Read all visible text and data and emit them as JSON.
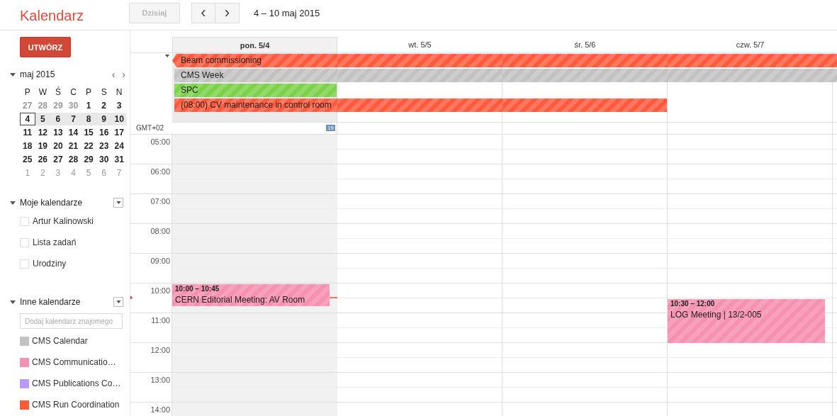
{
  "app_title": "Kalendarz",
  "toolbar": {
    "today_button": "Dzisiaj",
    "today_disabled": true,
    "prev": "‹",
    "next": "›",
    "range": "4 – 10 maj 2015"
  },
  "create_button": "UTWÓRZ",
  "mini_calendar": {
    "month": "maj 2015",
    "prev": "‹",
    "next": "›",
    "weekdays": [
      "P",
      "W",
      "Ś",
      "C",
      "P",
      "S",
      "N"
    ],
    "weeks": [
      {
        "selected": false,
        "days": [
          {
            "label": "27",
            "other_month": true,
            "selected": false
          },
          {
            "label": "28",
            "other_month": true,
            "selected": false
          },
          {
            "label": "29",
            "other_month": true,
            "selected": false
          },
          {
            "label": "30",
            "other_month": true,
            "selected": false
          },
          {
            "label": "1",
            "other_month": false,
            "selected": false
          },
          {
            "label": "2",
            "other_month": false,
            "selected": false
          },
          {
            "label": "3",
            "other_month": false,
            "selected": false
          }
        ]
      },
      {
        "selected": true,
        "days": [
          {
            "label": "4",
            "other_month": false,
            "selected": true
          },
          {
            "label": "5",
            "other_month": false,
            "selected": false
          },
          {
            "label": "6",
            "other_month": false,
            "selected": false
          },
          {
            "label": "7",
            "other_month": false,
            "selected": false
          },
          {
            "label": "8",
            "other_month": false,
            "selected": false
          },
          {
            "label": "9",
            "other_month": false,
            "selected": false
          },
          {
            "label": "10",
            "other_month": false,
            "selected": false
          }
        ]
      },
      {
        "selected": false,
        "days": [
          {
            "label": "11",
            "other_month": false,
            "selected": false
          },
          {
            "label": "12",
            "other_month": false,
            "selected": false
          },
          {
            "label": "13",
            "other_month": false,
            "selected": false
          },
          {
            "label": "14",
            "other_month": false,
            "selected": false
          },
          {
            "label": "15",
            "other_month": false,
            "selected": false
          },
          {
            "label": "16",
            "other_month": false,
            "selected": false
          },
          {
            "label": "17",
            "other_month": false,
            "selected": false
          }
        ]
      },
      {
        "selected": false,
        "days": [
          {
            "label": "18",
            "other_month": false,
            "selected": false
          },
          {
            "label": "19",
            "other_month": false,
            "selected": false
          },
          {
            "label": "20",
            "other_month": false,
            "selected": false
          },
          {
            "label": "21",
            "other_month": false,
            "selected": false
          },
          {
            "label": "22",
            "other_month": false,
            "selected": false
          },
          {
            "label": "23",
            "other_month": false,
            "selected": false
          },
          {
            "label": "24",
            "other_month": false,
            "selected": false
          }
        ]
      },
      {
        "selected": false,
        "days": [
          {
            "label": "25",
            "other_month": false,
            "selected": false
          },
          {
            "label": "26",
            "other_month": false,
            "selected": false
          },
          {
            "label": "27",
            "other_month": false,
            "selected": false
          },
          {
            "label": "28",
            "other_month": false,
            "selected": false
          },
          {
            "label": "29",
            "other_month": false,
            "selected": false
          },
          {
            "label": "30",
            "other_month": false,
            "selected": false
          },
          {
            "label": "31",
            "other_month": false,
            "selected": false
          }
        ]
      },
      {
        "selected": false,
        "days": [
          {
            "label": "1",
            "other_month": true,
            "selected": false
          },
          {
            "label": "2",
            "other_month": true,
            "selected": false
          },
          {
            "label": "3",
            "other_month": true,
            "selected": false
          },
          {
            "label": "4",
            "other_month": true,
            "selected": false
          },
          {
            "label": "5",
            "other_month": true,
            "selected": false
          },
          {
            "label": "6",
            "other_month": true,
            "selected": false
          },
          {
            "label": "7",
            "other_month": true,
            "selected": false
          }
        ]
      }
    ]
  },
  "my_calendars": {
    "title": "Moje kalendarze",
    "items": [
      {
        "name": "Artur Kalinowski",
        "checked": false
      },
      {
        "name": "Lista zadań",
        "checked": false
      },
      {
        "name": "Urodziny",
        "checked": false
      }
    ]
  },
  "other_calendars": {
    "title": "Inne kalendarze",
    "placeholder": "Dodaj kalendarz znajomego",
    "items": [
      {
        "name": "CMS Calendar",
        "color": "#c2c2c2"
      },
      {
        "name": "CMS Communicatio…",
        "color": "#f691b2"
      },
      {
        "name": "CMS Publications Co…",
        "color": "#b99aff"
      },
      {
        "name": "CMS Run Coordination",
        "color": "#ff5a3c"
      }
    ]
  },
  "timezone": "GMT+02",
  "days": [
    {
      "label": "pon. 5/4",
      "today": true,
      "badge": "19",
      "events": [
        {
          "time": "10:00 – 10:45",
          "title": "CERN Editorial Meeting: AV Room",
          "color": "#f691b2"
        }
      ]
    },
    {
      "label": "wt. 5/5",
      "today": false
    },
    {
      "label": "śr. 5/6",
      "today": false
    },
    {
      "label": "czw. 5/7",
      "today": false,
      "events": [
        {
          "time": "10:30 – 12:00",
          "title": "LOG Meeting | 13/2-005",
          "color": "#f691b2"
        }
      ]
    }
  ],
  "all_day_events": [
    {
      "title": "Beam commissioning",
      "color": "#ff5a3c",
      "continues_left": true,
      "continues_right": true,
      "spans": [
        true,
        true,
        true,
        true
      ]
    },
    {
      "title": "CMS Week",
      "color": "#c2c2c2",
      "continues_left": false,
      "continues_right": true,
      "spans": [
        true,
        true,
        true,
        true
      ]
    },
    {
      "title": "SPC",
      "color": "#7bd148",
      "continues_left": false,
      "continues_right": false,
      "spans": [
        true,
        false,
        false,
        false
      ]
    },
    {
      "title": "(08:00) CV maintenance in control room",
      "color": "#ff5a3c",
      "continues_left": false,
      "continues_right": false,
      "spans": [
        true,
        true,
        true,
        false
      ]
    }
  ],
  "hours": [
    "05:00",
    "06:00",
    "07:00",
    "08:00",
    "09:00",
    "10:00",
    "11:00",
    "12:00",
    "13:00",
    "14:00"
  ]
}
